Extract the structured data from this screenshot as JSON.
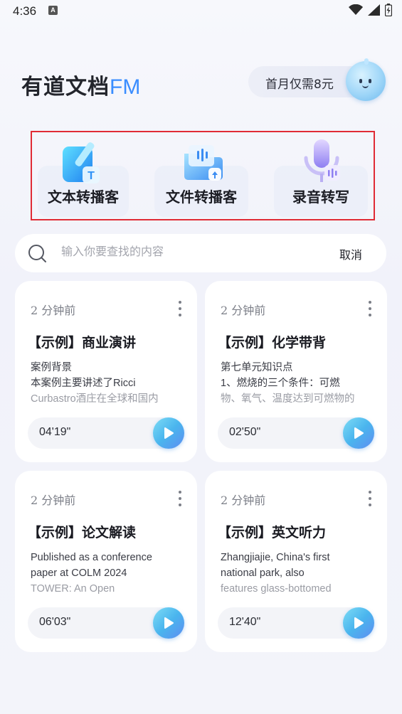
{
  "status": {
    "time": "4:36",
    "notif_letter": "A"
  },
  "header": {
    "logo_text": "有道文档",
    "logo_suffix": "FM",
    "promo_label": "首月仅需8元"
  },
  "tools": [
    {
      "label": "文本转播客",
      "icon": "text-podcast-icon"
    },
    {
      "label": "文件转播客",
      "icon": "file-podcast-icon"
    },
    {
      "label": "录音转写",
      "icon": "microphone-icon"
    }
  ],
  "search": {
    "placeholder": "输入你要查找的内容",
    "value": "",
    "cancel_label": "取消"
  },
  "cards": [
    {
      "time": "2 分钟前",
      "title": "【示例】商业演讲",
      "line1": "案例背景",
      "line2": "本案例主要讲述了Ricci",
      "line3": "Curbastro酒庄在全球和国内",
      "duration": "04'19\""
    },
    {
      "time": "2 分钟前",
      "title": "【示例】化学带背",
      "line1": "第七单元知识点",
      "line2": "1、燃烧的三个条件：可燃",
      "line3": "物、氧气、温度达到可燃物的",
      "duration": "02'50\""
    },
    {
      "time": "2 分钟前",
      "title": "【示例】论文解读",
      "line1": "Published as a conference",
      "line2": "paper at COLM 2024",
      "line3": "TOWER: An Open",
      "duration": "06'03\""
    },
    {
      "time": "2 分钟前",
      "title": "【示例】英文听力",
      "line1": "Zhangjiajie, China's first",
      "line2": "national park, also",
      "line3": "features glass-bottomed",
      "duration": "12'40\""
    }
  ],
  "colors": {
    "accent": "#3a8dff",
    "highlight_frame": "#e02b35",
    "play_gradient_start": "#7edcf5",
    "play_gradient_end": "#5e8df1"
  }
}
